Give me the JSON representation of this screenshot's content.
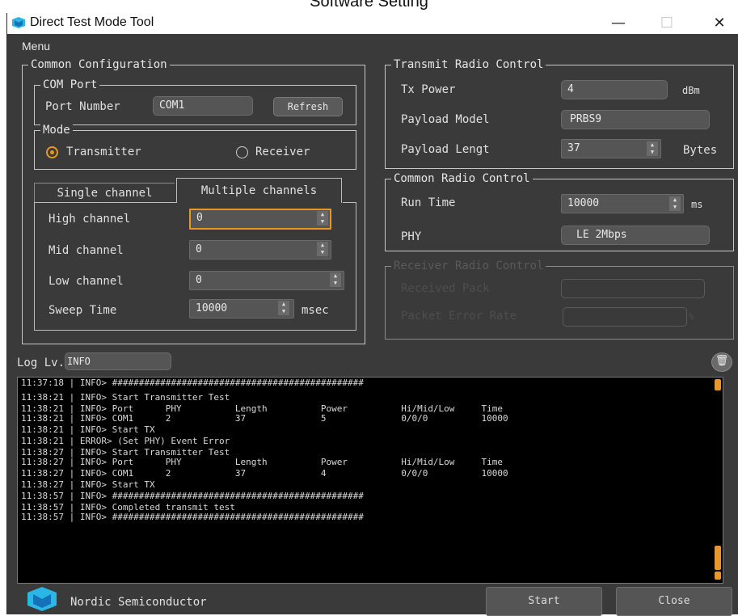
{
  "figure_caption": "Software Setting",
  "window": {
    "title": "Direct Test Mode Tool",
    "minimize": "—",
    "maximize": "☐",
    "close": "✕"
  },
  "menu": {
    "label": "Menu"
  },
  "common_config": {
    "legend": "Common Configuration",
    "com_port": {
      "legend": "COM Port",
      "port_label": "Port Number",
      "port_value": "COM1",
      "refresh_label": "Refresh"
    },
    "mode": {
      "legend": "Mode",
      "transmitter_label": "Transmitter",
      "receiver_label": "Receiver",
      "selected": "Transmitter"
    },
    "tabs": {
      "single": "Single channel",
      "multiple": "Multiple channels",
      "active": "Multiple channels"
    },
    "channels": {
      "high_label": "High channel",
      "high_value": "0",
      "mid_label": "Mid channel",
      "mid_value": "0",
      "low_label": "Low channel",
      "low_value": "0",
      "sweep_label": "Sweep Time",
      "sweep_value": "10000",
      "sweep_unit": "msec"
    }
  },
  "transmit": {
    "legend": "Transmit Radio Control",
    "tx_power_label": "Tx Power",
    "tx_power_value": "4",
    "tx_power_unit": "dBm",
    "payload_model_label": "Payload Model",
    "payload_model_value": "PRBS9",
    "payload_length_label": "Payload Lengt",
    "payload_length_value": "37",
    "payload_length_unit": "Bytes"
  },
  "common_radio": {
    "legend": "Common Radio Control",
    "run_time_label": "Run Time",
    "run_time_value": "10000",
    "run_time_unit": "ms",
    "phy_label": "PHY",
    "phy_value": "LE 2Mbps"
  },
  "receiver": {
    "legend": "Receiver Radio Control",
    "received_pack_label": "Received Pack",
    "received_pack_value": "",
    "per_label": "Packet Error Rate",
    "per_value": "",
    "per_unit": "%"
  },
  "log": {
    "level_label": "Log Lv.",
    "level_value": "INFO",
    "lines": [
      "11:37:18 | INFO> ###############################################",
      "11:38:21 | INFO> Start Transmitter Test",
      "11:38:21 | INFO> Port      PHY          Length          Power          Hi/Mid/Low     Time",
      "11:38:21 | INFO> COM1      2            37              5              0/0/0          10000",
      "11:38:21 | INFO> Start TX",
      "11:38:21 | ERROR> (Set PHY) Event Error",
      "11:38:27 | INFO> Start Transmitter Test",
      "11:38:27 | INFO> Port      PHY          Length          Power          Hi/Mid/Low     Time",
      "11:38:27 | INFO> COM1      2            37              4              0/0/0          10000",
      "11:38:27 | INFO> Start TX",
      "11:38:57 | INFO> ###############################################",
      "11:38:57 | INFO> Completed transmit test",
      "11:38:57 | INFO> ###############################################"
    ]
  },
  "footer": {
    "brand": "Nordic Semiconductor",
    "start_label": "Start",
    "close_label": "Close"
  },
  "colors": {
    "window_bg": "#3a3a3a",
    "field_bg": "#555555",
    "accent_orange": "#e8962a",
    "logo_blue": "#2bb6e6"
  }
}
